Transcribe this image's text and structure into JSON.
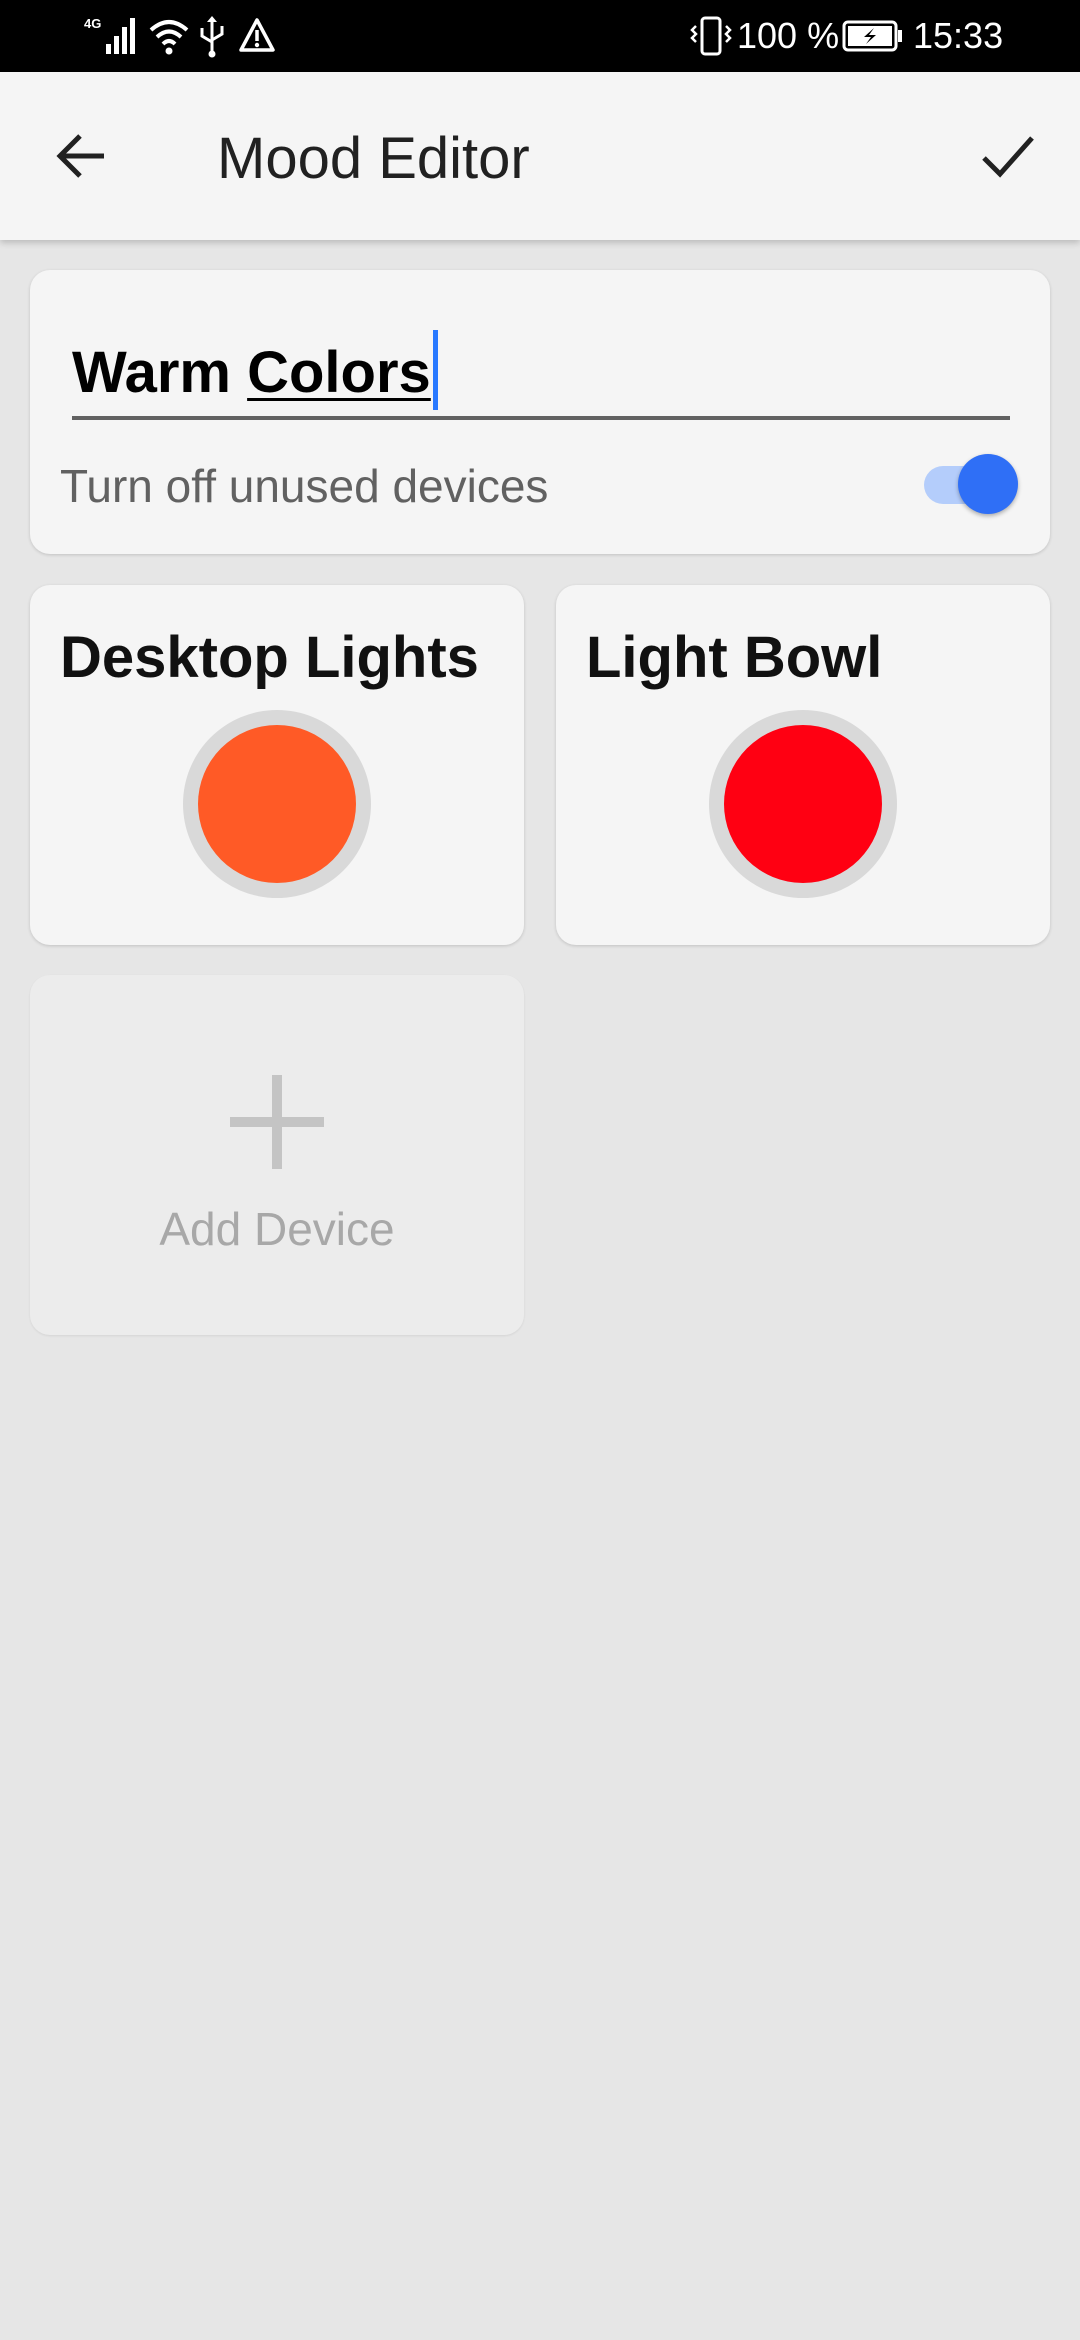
{
  "status_bar": {
    "network_label": "4G",
    "battery_percent": "100 %",
    "time": "15:33",
    "icons": [
      "signal-icon",
      "wifi-icon",
      "usb-icon",
      "warning-icon",
      "vibrate-icon",
      "battery-charging-icon"
    ]
  },
  "app_bar": {
    "title": "Mood Editor",
    "back_icon": "arrow-back-icon",
    "confirm_icon": "check-icon"
  },
  "mood": {
    "name_part1": "Warm ",
    "name_part2": "Colors",
    "toggle_label": "Turn off unused devices",
    "toggle_on": true,
    "accent_color": "#2f6ff6"
  },
  "devices": [
    {
      "name": "Desktop Lights",
      "color": "#ff5a26"
    },
    {
      "name": "Light Bowl",
      "color": "#ff0012"
    }
  ],
  "add_device": {
    "label": "Add Device",
    "icon": "plus-icon"
  }
}
